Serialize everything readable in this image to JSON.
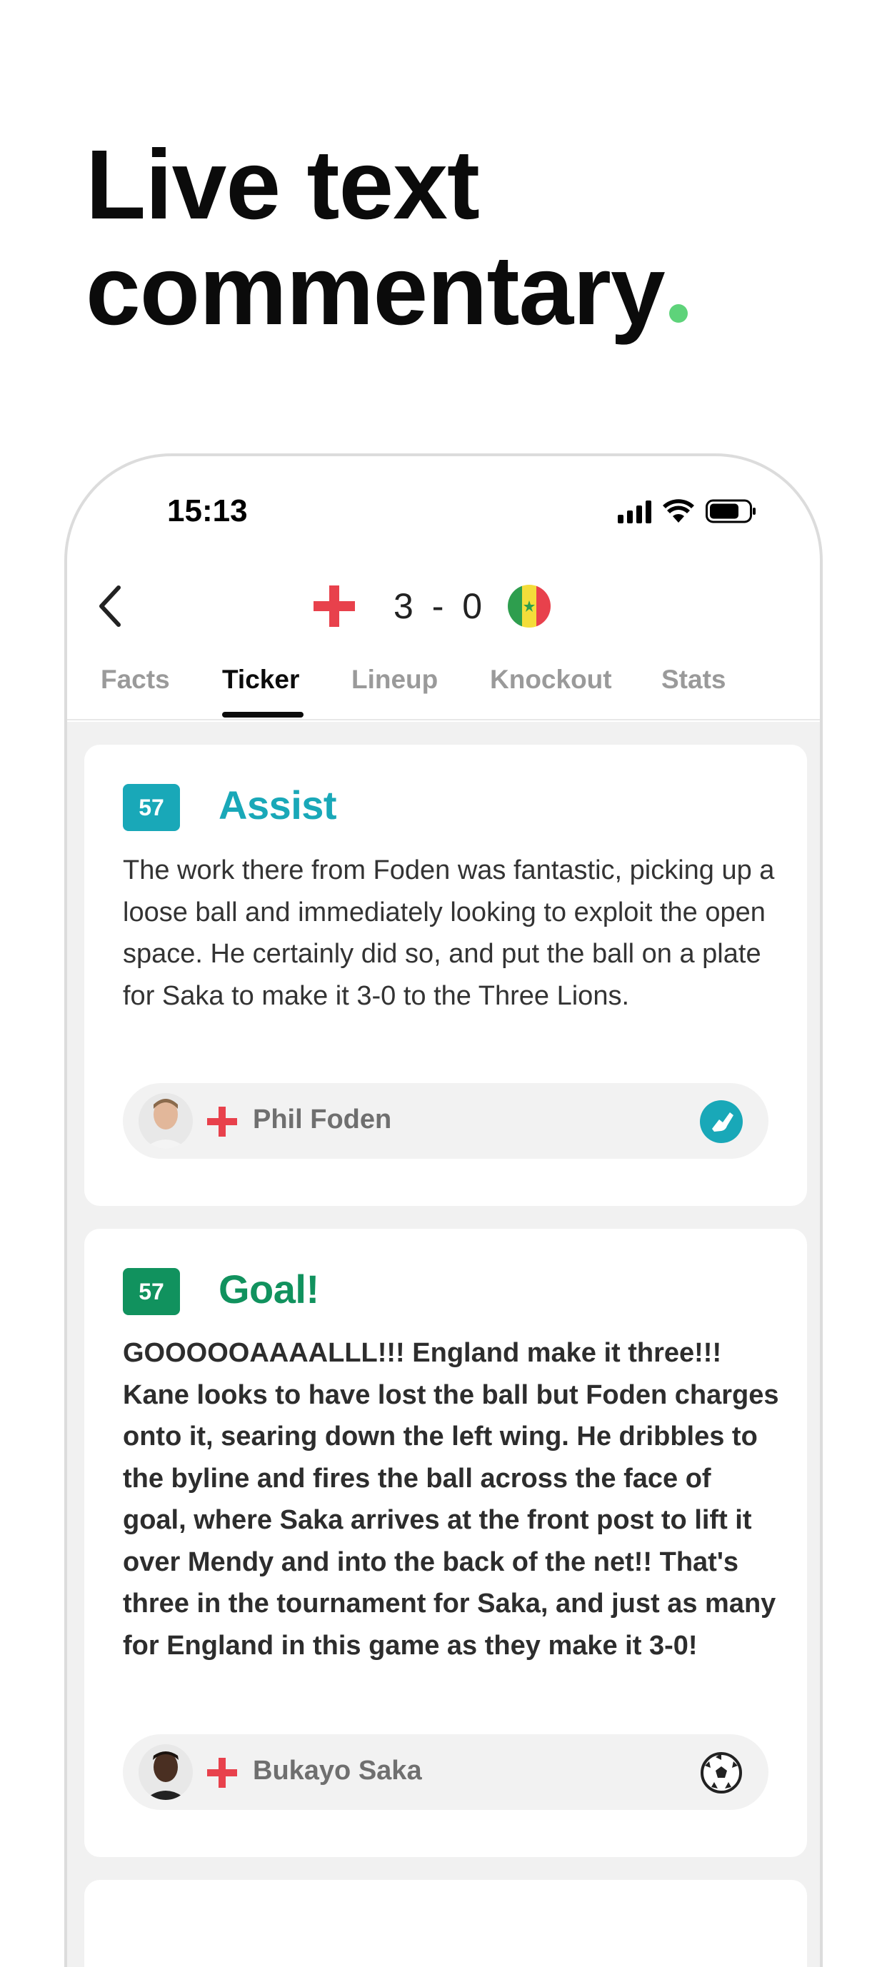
{
  "hero": {
    "line1": "Live text",
    "line2": "commentary",
    "accent_color": "#5ed37a"
  },
  "status_bar": {
    "time": "15:13",
    "icons": [
      "cellular-signal-icon",
      "wifi-icon",
      "battery-icon"
    ]
  },
  "match": {
    "home_flag": "england-flag-icon",
    "away_flag": "senegal-flag-icon",
    "score": "3 - 0"
  },
  "tabs": [
    {
      "label": "Facts",
      "active": false
    },
    {
      "label": "Ticker",
      "active": true
    },
    {
      "label": "Lineup",
      "active": false
    },
    {
      "label": "Knockout",
      "active": false
    },
    {
      "label": "Stats",
      "active": false
    }
  ],
  "events": [
    {
      "minute": "57",
      "title": "Assist",
      "color": "#19a8b8",
      "text": "The work there from Foden was fantastic, picking up a loose ball and immediately looking to exploit the open space. He certainly did so, and put the ball on a plate for Saka to make it 3-0 to the Three Lions.",
      "player": "Phil Foden",
      "icon": "boot-assist-icon"
    },
    {
      "minute": "57",
      "title": "Goal!",
      "color": "#11925e",
      "text": "GOOOOOAAAALLL!!! England make it three!!! Kane looks to have lost the ball but Foden charges onto it, searing down the left wing. He dribbles to the byline and fires the ball across the face of goal, where Saka arrives at the front post to lift it over Mendy and into the back of the net!! That's three in the tournament for Saka, and just as many for England in this game as they make it 3-0!",
      "player": "Bukayo Saka",
      "icon": "football-icon"
    }
  ]
}
